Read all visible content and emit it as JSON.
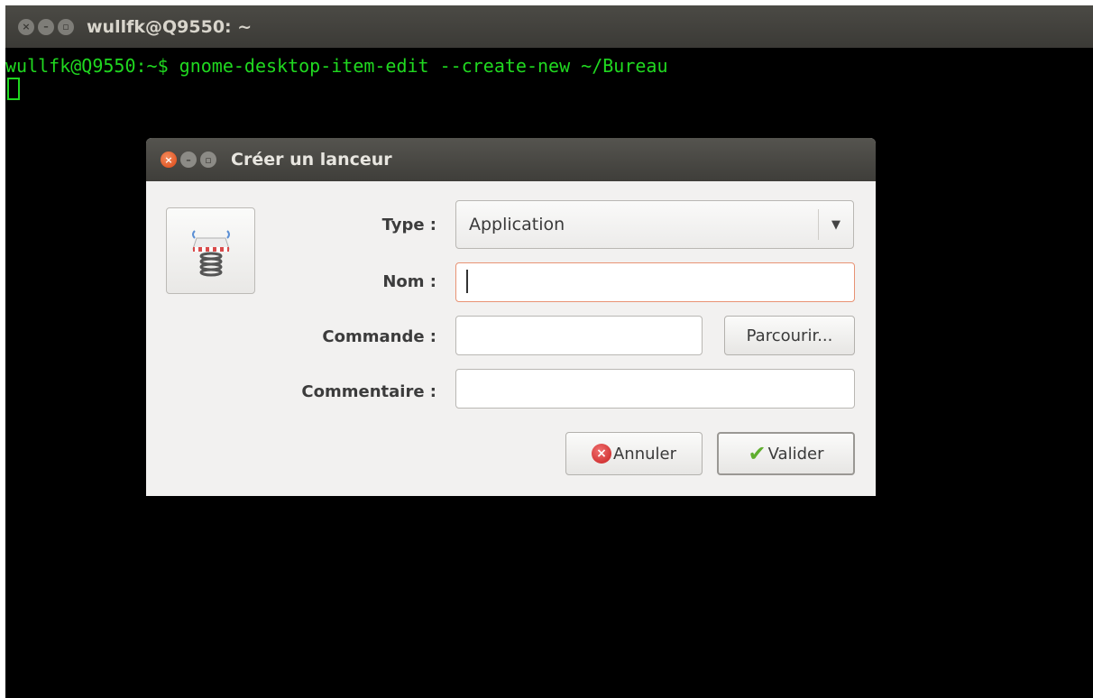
{
  "terminal": {
    "title": "wullfk@Q9550: ~",
    "command_line": "wullfk@Q9550:~$ gnome-desktop-item-edit --create-new ~/Bureau",
    "text_color": "#20d820"
  },
  "dialog": {
    "title": "Créer un lanceur",
    "type_label": "Type :",
    "type_value": "Application",
    "nom_label": "Nom :",
    "nom_value": "",
    "commande_label": "Commande :",
    "commande_value": "",
    "browse_label": "Parcourir...",
    "commentaire_label": "Commentaire :",
    "commentaire_value": "",
    "cancel_label": "Annuler",
    "ok_label": "Valider",
    "launcher_icon": "spring-launcher-icon"
  }
}
